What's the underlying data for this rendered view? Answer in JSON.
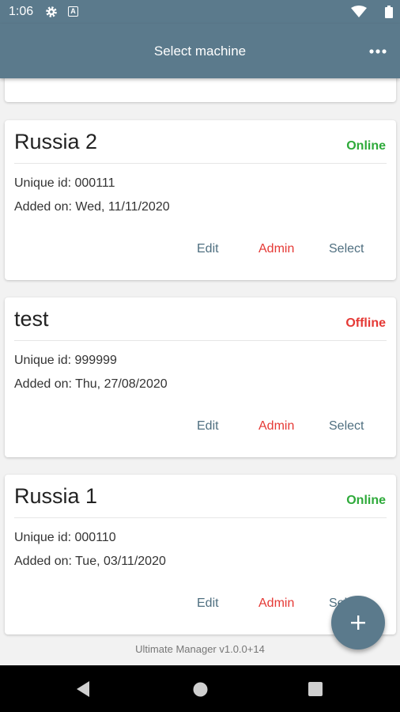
{
  "status_bar": {
    "time": "1:06"
  },
  "app_bar": {
    "title": "Select machine"
  },
  "labels": {
    "unique_id_prefix": "Unique id: ",
    "added_on_prefix": "Added on: "
  },
  "machines": [
    {
      "name": "Russia 2",
      "status": "Online",
      "unique_id": "000111",
      "added_on": "Wed, 11/11/2020"
    },
    {
      "name": "test",
      "status": "Offline",
      "unique_id": "999999",
      "added_on": "Thu, 27/08/2020"
    },
    {
      "name": "Russia 1",
      "status": "Online",
      "unique_id": "000110",
      "added_on": "Tue, 03/11/2020"
    }
  ],
  "actions": {
    "edit": "Edit",
    "admin": "Admin",
    "select": "Select"
  },
  "footer": {
    "version": "Ultimate Manager v1.0.0+14"
  },
  "colors": {
    "primary": "#5b7a8c",
    "online": "#2eaa3a",
    "offline": "#e53935",
    "action": "#4f6f80"
  },
  "icons": {
    "settings": "gear-icon",
    "a": "a-icon",
    "wifi": "wifi-icon",
    "battery": "battery-icon",
    "more": "more-options-icon",
    "add": "plus-icon",
    "back": "nav-back-icon",
    "home": "nav-home-icon",
    "recents": "nav-recents-icon"
  }
}
